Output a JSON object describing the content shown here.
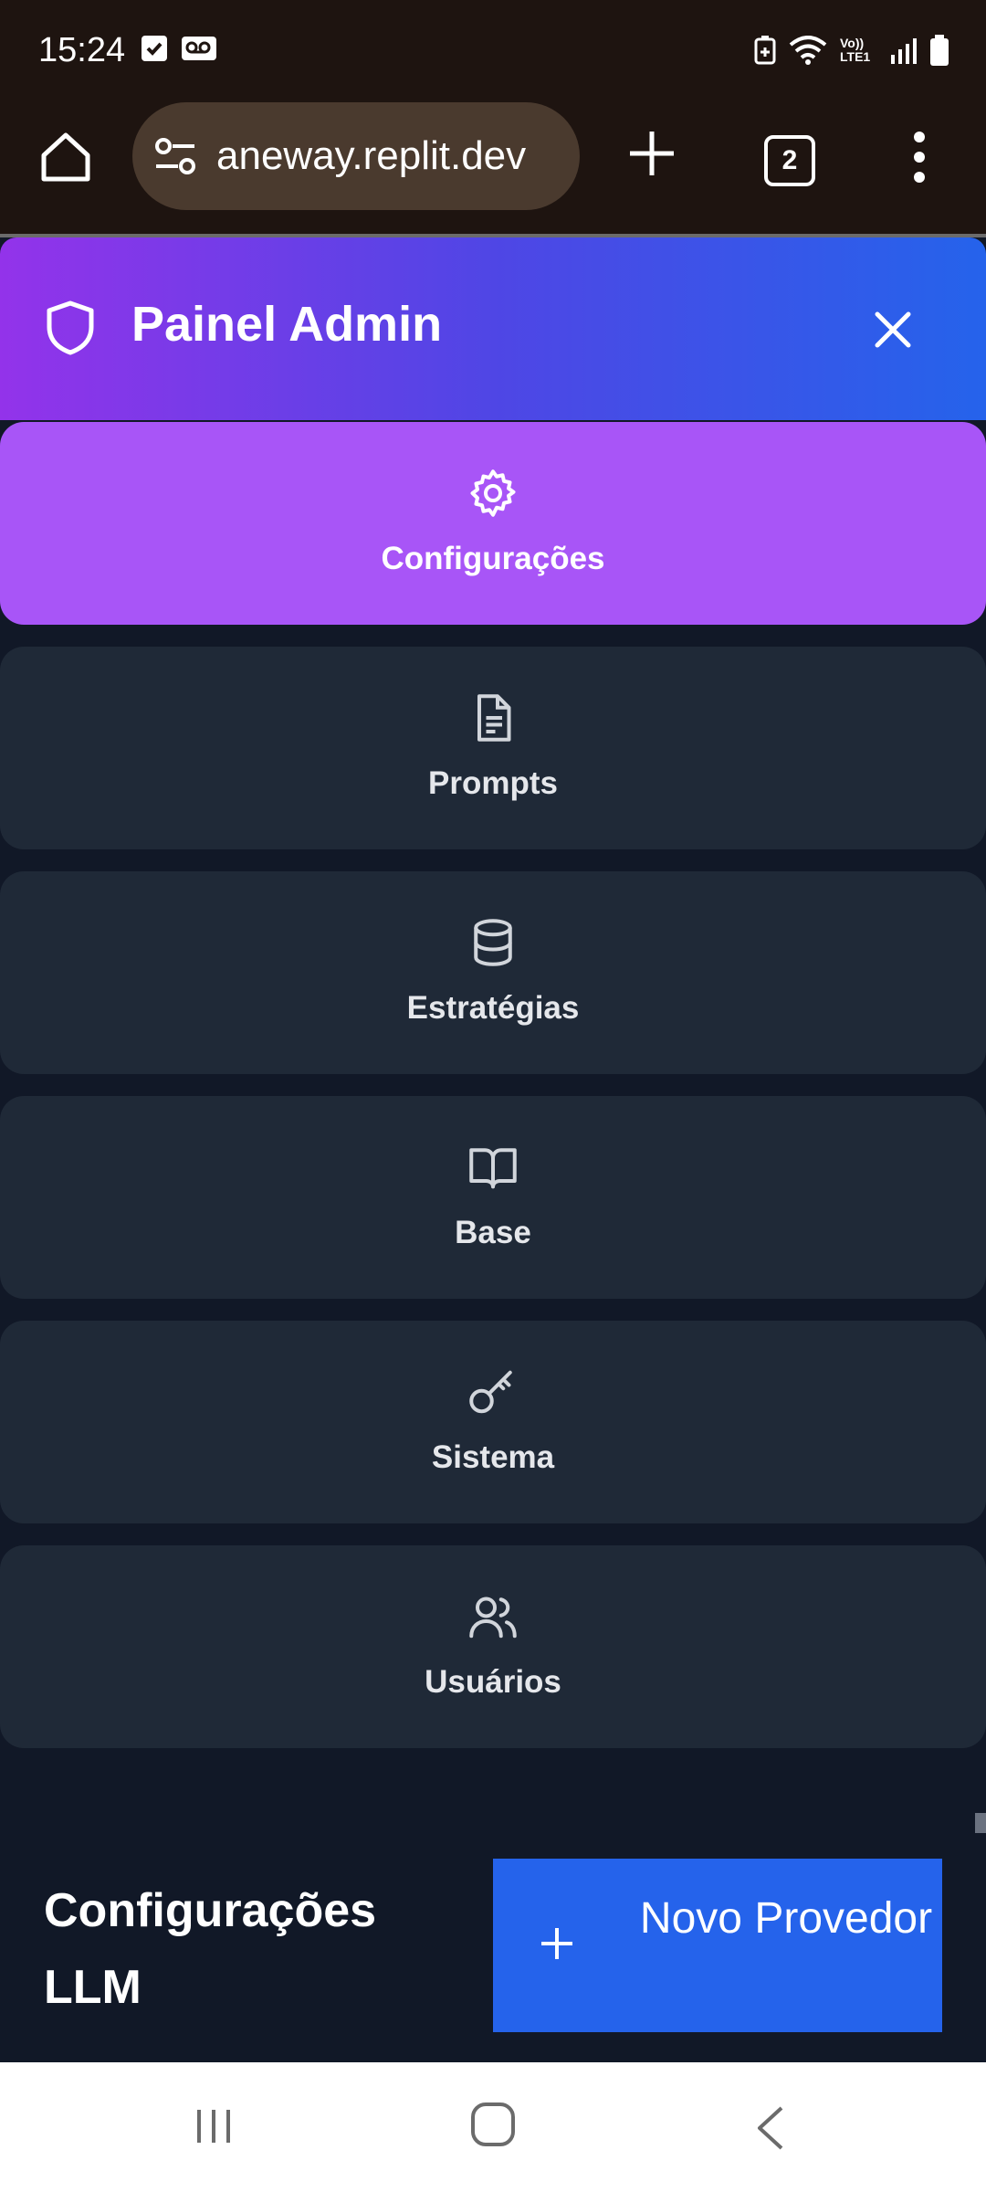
{
  "status_bar": {
    "time": "15:24",
    "icons": [
      "check-notification-icon",
      "voicemail-icon",
      "battery-saver-icon",
      "wifi-icon",
      "volte-icon",
      "signal-icon",
      "battery-icon"
    ],
    "volte_label": "Vo)) LTE1"
  },
  "browser": {
    "url": "aneway.replit.dev",
    "tab_count": "2"
  },
  "admin": {
    "title": "Painel Admin"
  },
  "nav": {
    "items": [
      {
        "label": "Configurações",
        "icon": "gear-icon",
        "active": true
      },
      {
        "label": "Prompts",
        "icon": "document-icon",
        "active": false
      },
      {
        "label": "Estratégias",
        "icon": "database-icon",
        "active": false
      },
      {
        "label": "Base",
        "icon": "book-icon",
        "active": false
      },
      {
        "label": "Sistema",
        "icon": "key-icon",
        "active": false
      },
      {
        "label": "Usuários",
        "icon": "users-icon",
        "active": false
      }
    ]
  },
  "section": {
    "title": "Configurações LLM",
    "new_button": "Novo Provedor"
  },
  "colors": {
    "active_nav": "#a855f7",
    "nav_bg": "#1f2937",
    "page_bg": "#111827",
    "primary_button": "#2563eb",
    "header_gradient_start": "#9333ea",
    "header_gradient_end": "#2563eb"
  }
}
